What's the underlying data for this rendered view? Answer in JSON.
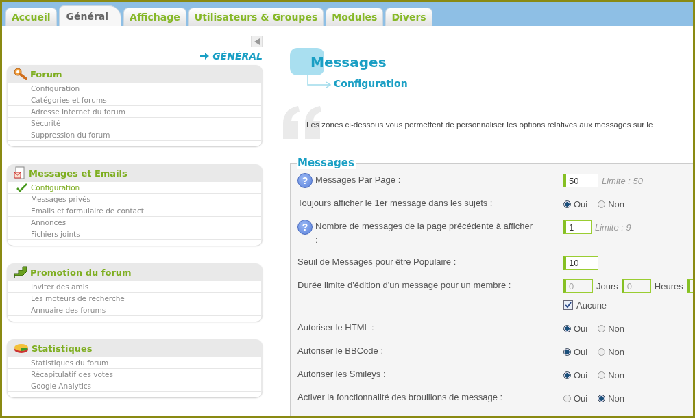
{
  "tabs": [
    {
      "label": "Accueil",
      "selected": false
    },
    {
      "label": "Général",
      "selected": true
    },
    {
      "label": "Affichage",
      "selected": false
    },
    {
      "label": "Utilisateurs & Groupes",
      "selected": false
    },
    {
      "label": "Modules",
      "selected": false
    },
    {
      "label": "Divers",
      "selected": false
    }
  ],
  "sidebar": {
    "heading": "GÉNÉRAL",
    "sections": [
      {
        "title": "Forum",
        "items": [
          {
            "label": "Configuration",
            "selected": false
          },
          {
            "label": "Catégories et forums",
            "selected": false
          },
          {
            "label": "Adresse Internet du forum",
            "selected": false
          },
          {
            "label": "Sécurité",
            "selected": false
          },
          {
            "label": "Suppression du forum",
            "selected": false
          }
        ]
      },
      {
        "title": "Messages et Emails",
        "items": [
          {
            "label": "Configuration",
            "selected": true
          },
          {
            "label": "Messages privés",
            "selected": false
          },
          {
            "label": "Emails et formulaire de contact",
            "selected": false
          },
          {
            "label": "Annonces",
            "selected": false
          },
          {
            "label": "Fichiers joints",
            "selected": false
          }
        ]
      },
      {
        "title": "Promotion du forum",
        "items": [
          {
            "label": "Inviter des amis",
            "selected": false
          },
          {
            "label": "Les moteurs de recherche",
            "selected": false
          },
          {
            "label": "Annuaire des forums",
            "selected": false
          }
        ]
      },
      {
        "title": "Statistiques",
        "items": [
          {
            "label": "Statistiques du forum",
            "selected": false
          },
          {
            "label": "Récapitulatif des votes",
            "selected": false
          },
          {
            "label": "Google Analytics",
            "selected": false
          }
        ]
      }
    ]
  },
  "main": {
    "title": "Messages",
    "subtitle": "Configuration",
    "intro": "Les zones ci-dessous vous permettent de personnaliser les options relatives aux messages sur le",
    "fieldset": {
      "legend": "Messages",
      "rows": [
        {
          "kind": "number",
          "label": "Messages Par Page :",
          "help": "?",
          "value": "50",
          "limit": "Limite : 50"
        },
        {
          "kind": "radio",
          "label": "Toujours afficher le 1er message dans les sujets :",
          "options": [
            {
              "label": "Oui",
              "selected": true
            },
            {
              "label": "Non",
              "selected": false
            }
          ]
        },
        {
          "kind": "number",
          "label": "Nombre de messages de la page précédente à afficher :",
          "help": "?",
          "value": "1",
          "limit": "Limite : 9"
        },
        {
          "kind": "number",
          "label": "Seuil de Messages pour être Populaire :",
          "value": "10"
        },
        {
          "kind": "duration",
          "label": "Durée limite d'édition d'un message pour un membre :",
          "fields": [
            {
              "value": "0",
              "unit": "Jours",
              "disabled": true
            },
            {
              "value": "0",
              "unit": "Heures",
              "disabled": true
            },
            {
              "disabled": true
            }
          ],
          "none_option": {
            "label": "Aucune",
            "checked": true
          }
        },
        {
          "kind": "radio",
          "label": "Autoriser le HTML :",
          "options": [
            {
              "label": "Oui",
              "selected": true
            },
            {
              "label": "Non",
              "selected": false
            }
          ]
        },
        {
          "kind": "radio",
          "label": "Autoriser le BBCode :",
          "options": [
            {
              "label": "Oui",
              "selected": true
            },
            {
              "label": "Non",
              "selected": false
            }
          ]
        },
        {
          "kind": "radio",
          "label": "Autoriser les Smileys :",
          "options": [
            {
              "label": "Oui",
              "selected": true
            },
            {
              "label": "Non",
              "selected": false
            }
          ]
        },
        {
          "kind": "radio",
          "label": "Activer la fonctionnalité des brouillons de message :",
          "options": [
            {
              "label": "Oui",
              "selected": false
            },
            {
              "label": "Non",
              "selected": true
            }
          ]
        }
      ]
    }
  }
}
